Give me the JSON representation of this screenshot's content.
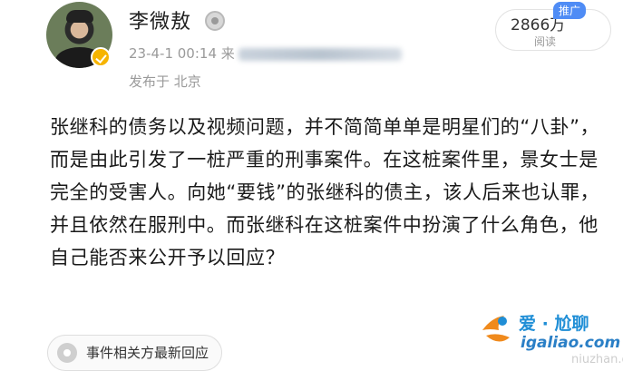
{
  "post": {
    "author": "李微敖",
    "time": "23-4-1 00:14",
    "source_prefix": "来",
    "location": "发布于 北京",
    "reads_count": "2866万",
    "reads_label": "阅读",
    "promo_tag": "推广",
    "body": "张继科的债务以及视频问题，并不简简单单是明星们的“八卦”，而是由此引发了一桩严重的刑事案件。在这桩案件里，景女士是完全的受害人。向她“要钱”的张继科的债主，该人后来也认罪，并且依然在服刑中。而张继科在这桩案件中扮演了什么角色，他自己能否来公开予以回应？",
    "related_chip": "事件相关方最新回应"
  },
  "watermark": {
    "cn_text": "爱 · 尬聊",
    "url_text": "igaliao.com",
    "ghost_text": "niuzhan.com"
  },
  "colors": {
    "accent": "#4f8cf5",
    "verified": "#f6b400",
    "watermark_blue": "#1f8ed6",
    "watermark_orange": "#f08a1c"
  }
}
